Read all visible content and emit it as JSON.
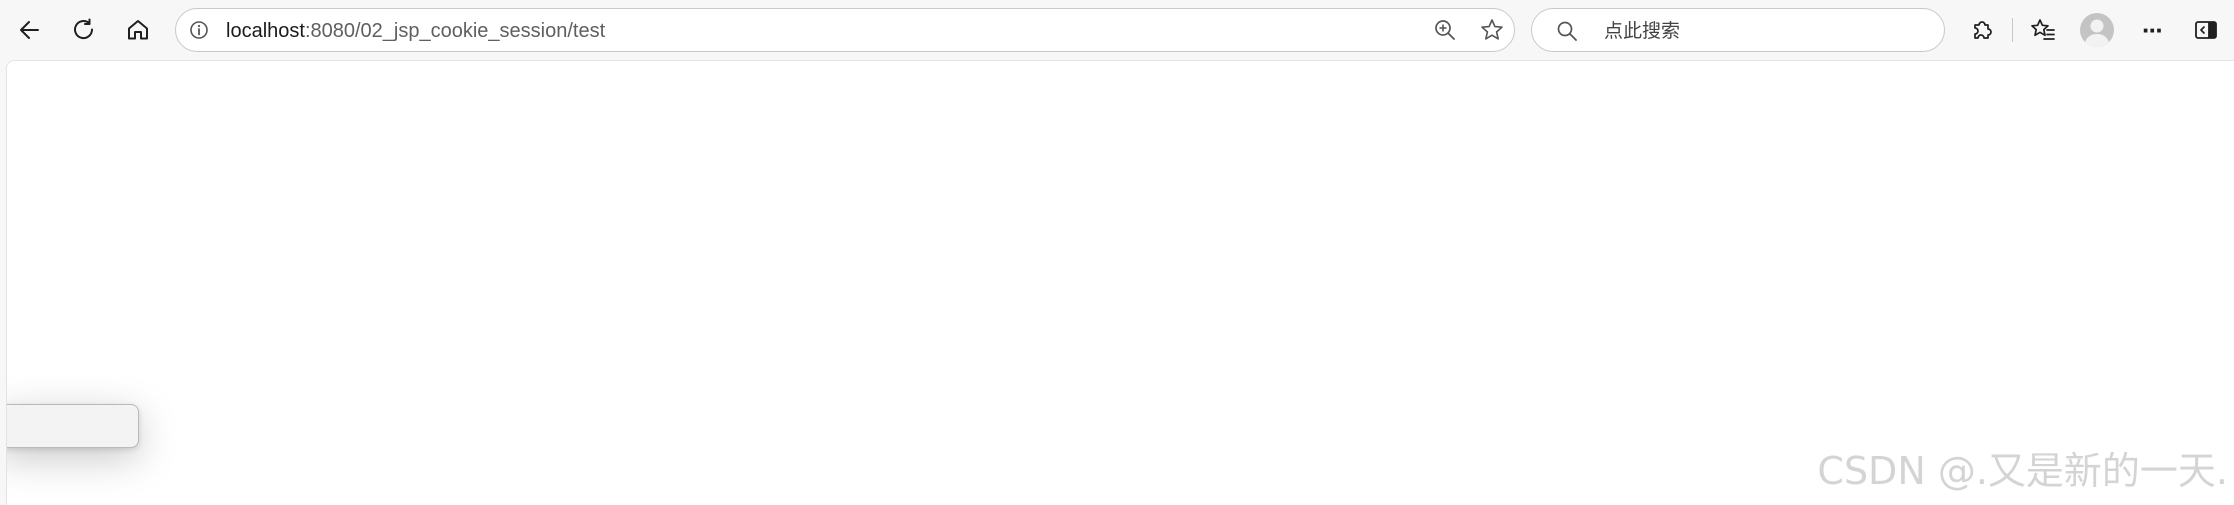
{
  "toolbar": {
    "back_icon": "arrow-left-icon",
    "refresh_icon": "refresh-icon",
    "home_icon": "home-icon",
    "extensions_icon": "puzzle-icon",
    "favorites_icon": "favorites-list-icon",
    "more_label": "···",
    "sidebar_icon": "sidebar-toggle-icon"
  },
  "address_bar": {
    "host": "localhost",
    "path": ":8080/02_jsp_cookie_session/test",
    "info_icon": "info-icon",
    "zoom_icon": "zoom-in-icon",
    "favorite_icon": "star-icon"
  },
  "search": {
    "placeholder": "点此搜索",
    "icon": "search-icon"
  },
  "page": {
    "watermark": "CSDN @.又是新的一天."
  },
  "colors": {
    "toolbar_bg": "#f7f7f7",
    "content_bg": "#ffffff",
    "icon": "#1f1f1f"
  }
}
